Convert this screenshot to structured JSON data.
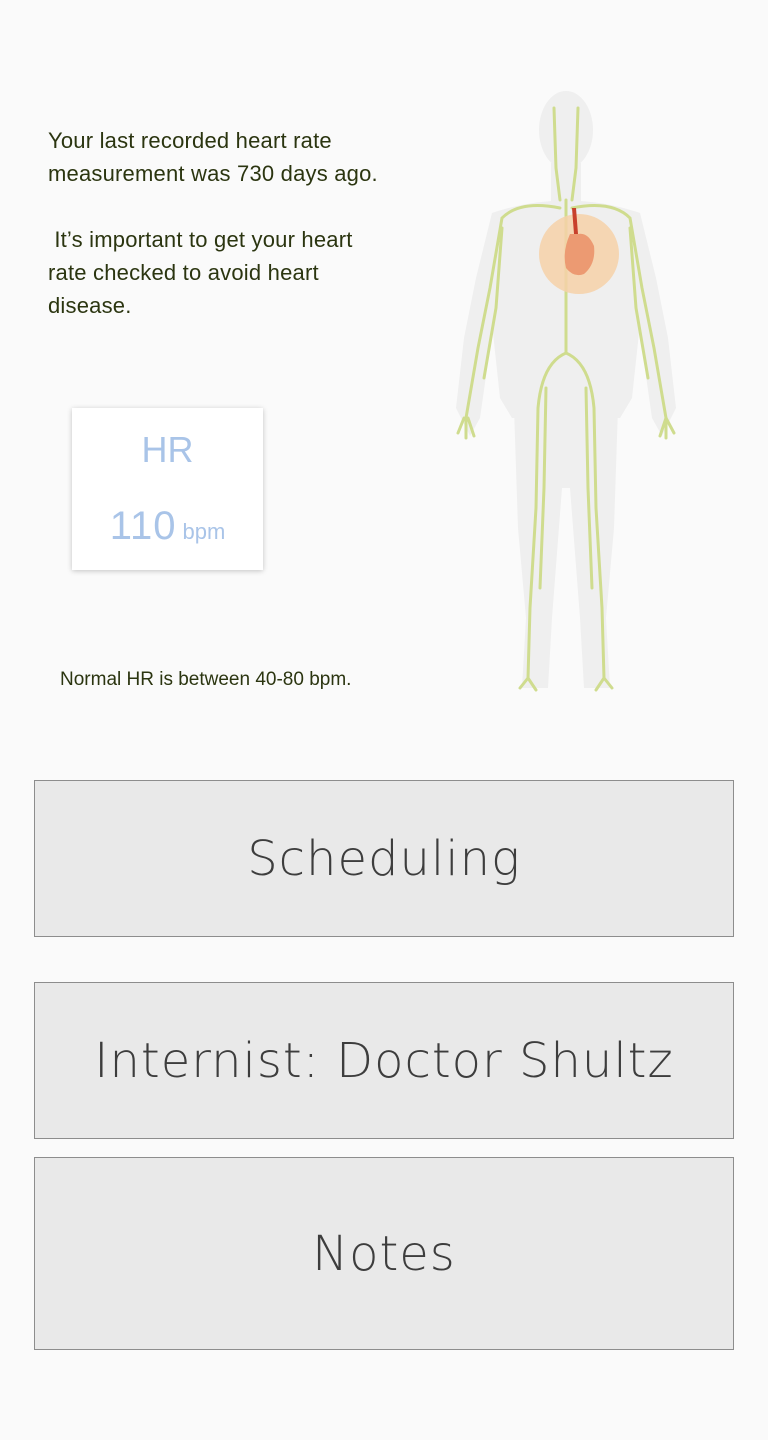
{
  "info": {
    "last_measurement": "Your last recorded heart rate measurement was 730 days ago.",
    "warning": " It’s important to get your heart rate checked to avoid heart disease."
  },
  "hr_card": {
    "label": "HR",
    "value": "110",
    "unit": "bpm"
  },
  "normal_note": "Normal HR is between 40-80 bpm.",
  "body_figure": {
    "icon": "circulatory-system-illustration",
    "colors": {
      "silhouette": "#efefef",
      "vessels": "#cfdc8e",
      "heart_highlight": "#f6d1a8",
      "heart": "#ec9a72",
      "aorta": "#c8412c"
    }
  },
  "buttons": {
    "scheduling": "Scheduling",
    "internist": "Internist: Doctor Shultz",
    "notes": "Notes"
  }
}
